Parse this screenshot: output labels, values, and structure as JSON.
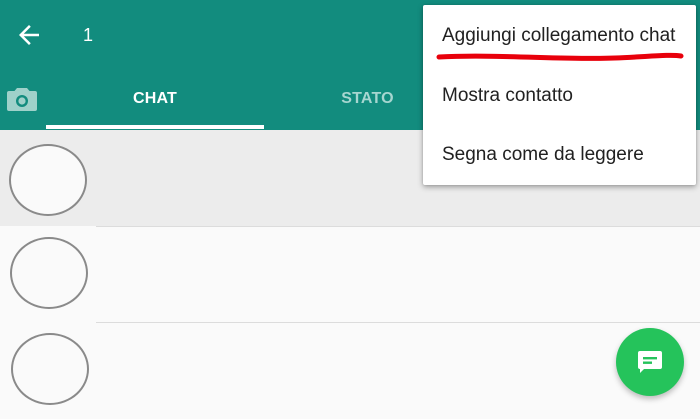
{
  "header": {
    "selected_count": "1",
    "back_icon": "arrow-left-icon",
    "background_color": "#128c7e"
  },
  "tabs": [
    {
      "icon": "camera-icon"
    },
    {
      "label": "CHAT",
      "active": true
    },
    {
      "label": "STATO",
      "active": false
    }
  ],
  "chat_list": [
    {
      "avatar_icon": "contact-avatar",
      "selected": true
    },
    {
      "avatar_icon": "contact-avatar",
      "selected": false
    },
    {
      "avatar_icon": "contact-avatar",
      "selected": false
    }
  ],
  "overflow_menu": {
    "items": [
      {
        "label": "Aggiungi collegamento chat",
        "highlighted": true
      },
      {
        "label": "Mostra contatto"
      },
      {
        "label": "Segna come da leggere"
      }
    ],
    "highlight_color": "#e8000b"
  },
  "fab": {
    "icon": "new-chat-icon",
    "color": "#25c35b"
  }
}
